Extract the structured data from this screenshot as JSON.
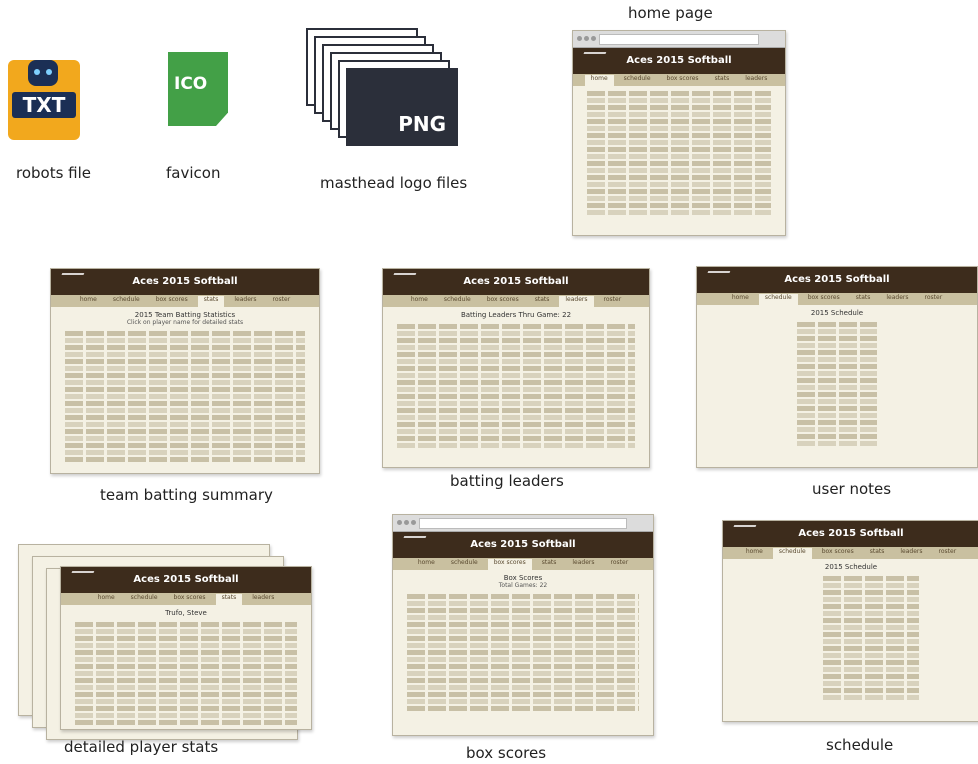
{
  "files": {
    "robots": {
      "label": "robots file",
      "icon_text": "TXT",
      "icon": "txt-robot-icon"
    },
    "favicon": {
      "label": "favicon",
      "icon_text": "ICO",
      "icon": "ico-file-icon"
    },
    "logos": {
      "label": "masthead logo files",
      "icon_text": "PNG",
      "icon": "png-stack-icon"
    }
  },
  "pages": {
    "home": {
      "label": "home page",
      "site_title": "Aces 2015 Softball"
    },
    "batting_summary": {
      "label": "team batting summary",
      "site_title": "Aces 2015 Softball",
      "heading": "2015 Team Batting Statistics",
      "sub": "Click on player name for detailed stats"
    },
    "batting_leaders": {
      "label": "batting leaders",
      "site_title": "Aces 2015 Softball",
      "heading": "Batting Leaders Thru Game: 22"
    },
    "user_notes": {
      "label": "user notes",
      "site_title": "Aces 2015 Softball",
      "heading": "2015 Schedule"
    },
    "player_stats": {
      "label": "detailed player stats",
      "site_title": "Aces 2015 Softball",
      "heading": "Trufo, Steve"
    },
    "box_scores": {
      "label": "box scores",
      "site_title": "Aces 2015 Softball",
      "heading": "Box Scores",
      "sub": "Total Games: 22"
    },
    "schedule": {
      "label": "schedule",
      "site_title": "Aces 2015 Softball",
      "heading": "2015 Schedule"
    }
  },
  "nav": [
    "home",
    "schedule",
    "box scores",
    "stats",
    "leaders",
    "roster"
  ],
  "colors": {
    "masthead": "#3d2c1c",
    "page_bg": "#f4f1e4",
    "nav_bg": "#c9c0a0",
    "txt_icon": "#f2a81d",
    "ico_icon": "#43a047",
    "png_icon": "#2b2f3a"
  }
}
